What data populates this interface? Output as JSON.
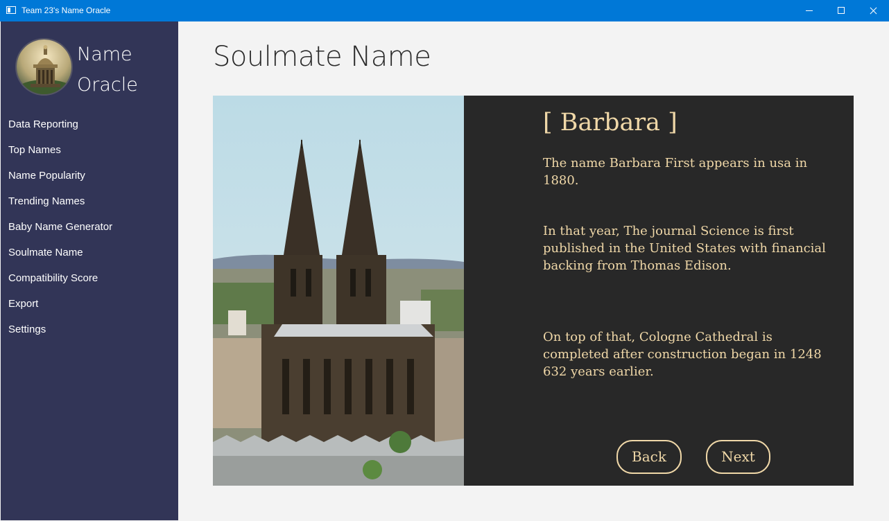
{
  "window": {
    "title": "Team 23's Name Oracle"
  },
  "sidebar": {
    "brand_line1": "Name",
    "brand_line2": "Oracle",
    "items": [
      {
        "label": "Data Reporting"
      },
      {
        "label": "Top Names"
      },
      {
        "label": "Name Popularity"
      },
      {
        "label": "Trending Names"
      },
      {
        "label": "Baby Name Generator"
      },
      {
        "label": "Soulmate Name"
      },
      {
        "label": "Compatibility Score"
      },
      {
        "label": "Export"
      },
      {
        "label": "Settings"
      }
    ]
  },
  "main": {
    "page_title": "Soulmate Name",
    "result": {
      "name": "[ Barbara ]",
      "para1": "The name Barbara First appears in usa in 1880.",
      "para2": "In that year, The journal Science is first published in the United States with financial backing from Thomas Edison.",
      "para3": "On top of that, Cologne Cathedral is completed after construction began in 1248 632 years earlier."
    },
    "buttons": {
      "back": "Back",
      "next": "Next"
    }
  },
  "colors": {
    "titlebar": "#0078d7",
    "sidebar": "#323557",
    "panel": "#282828",
    "panel_text": "#f0d8a8",
    "page_bg": "#f3f3f3"
  }
}
